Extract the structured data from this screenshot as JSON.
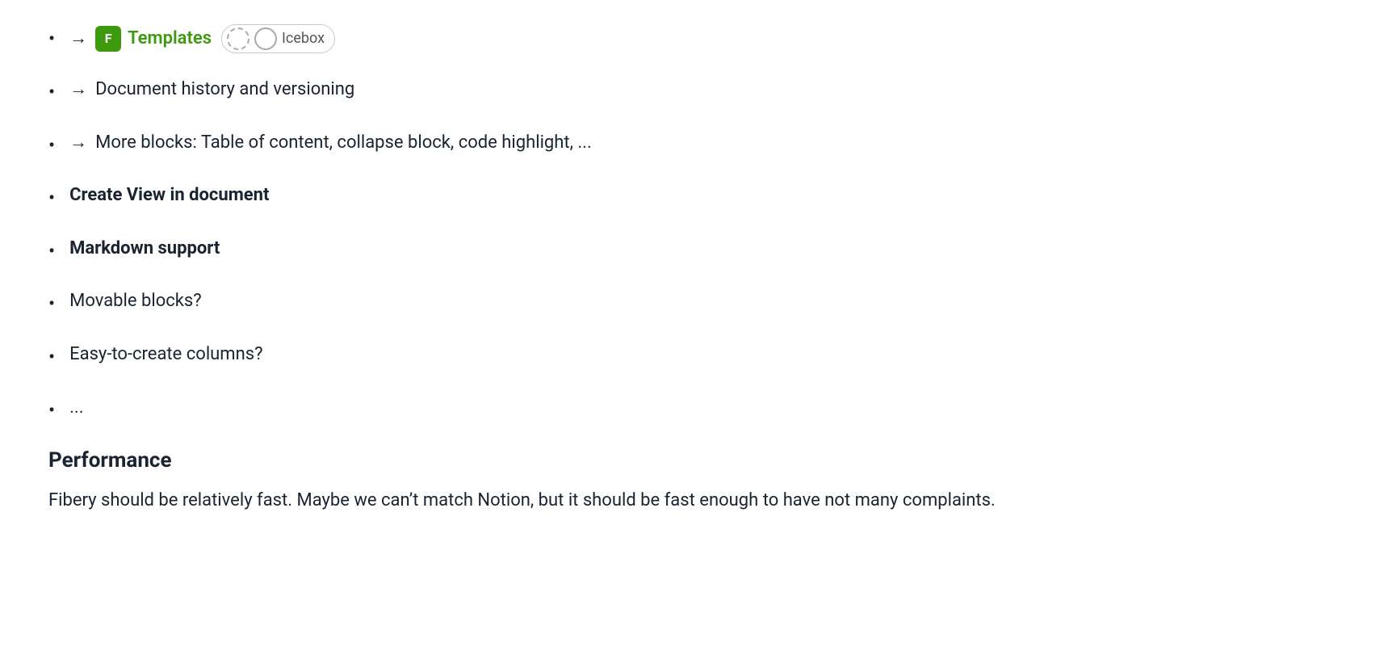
{
  "list": {
    "items": [
      {
        "id": "templates",
        "arrow": "→",
        "badge": "F",
        "label": "Templates",
        "has_status": true,
        "status_dashed": true,
        "icebox_label": "Icebox",
        "bold": false
      },
      {
        "id": "doc-history",
        "arrow": "→",
        "label": "Document history and versioning",
        "has_status": false,
        "bold": false
      },
      {
        "id": "more-blocks",
        "arrow": "→",
        "label": "More blocks: Table of content, collapse block, code highlight, ...",
        "has_status": false,
        "bold": false
      },
      {
        "id": "create-view",
        "arrow": null,
        "label": "Create View in document",
        "has_status": false,
        "bold": true
      },
      {
        "id": "markdown",
        "arrow": null,
        "label": "Markdown support",
        "has_status": false,
        "bold": true
      },
      {
        "id": "movable-blocks",
        "arrow": null,
        "label": "Movable blocks?",
        "has_status": false,
        "bold": false
      },
      {
        "id": "easy-columns",
        "arrow": null,
        "label": "Easy-to-create columns?",
        "has_status": false,
        "bold": false
      },
      {
        "id": "ellipsis",
        "arrow": null,
        "label": "...",
        "has_status": false,
        "bold": false
      }
    ]
  },
  "performance": {
    "heading": "Performance",
    "paragraph": "Fibery should be relatively fast. Maybe we can’t match Notion, but it should be fast enough to have not many complaints."
  },
  "icons": {
    "bullet": "•",
    "arrow": "→"
  }
}
